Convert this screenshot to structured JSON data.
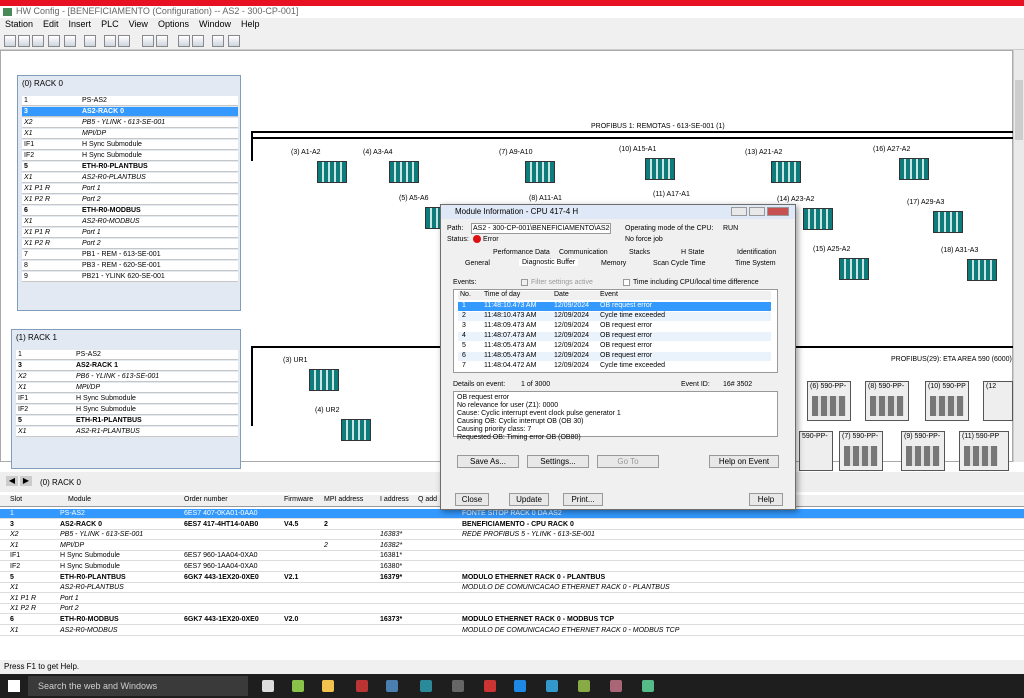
{
  "window": {
    "title": "HW Config - [BENEFICIAMENTO (Configuration) -- AS2 - 300-CP-001]"
  },
  "menu": [
    "Station",
    "Edit",
    "Insert",
    "PLC",
    "View",
    "Options",
    "Window",
    "Help"
  ],
  "racks": {
    "rack0": {
      "title": "(0) RACK 0",
      "rows": [
        {
          "slot": "1",
          "module": "PS-AS2",
          "style": ""
        },
        {
          "slot": "3",
          "module": "AS2-RACK 0",
          "style": "sel"
        },
        {
          "slot": "X2",
          "module": "PB5 - YLINK - 613-SE-001",
          "style": "it"
        },
        {
          "slot": "X1",
          "module": "MPI/DP",
          "style": "it"
        },
        {
          "slot": "IF1",
          "module": "H Sync Submodule",
          "style": ""
        },
        {
          "slot": "IF2",
          "module": "H Sync Submodule",
          "style": ""
        },
        {
          "slot": "5",
          "module": "ETH-R0-PLANTBUS",
          "style": "bold"
        },
        {
          "slot": "X1",
          "module": "AS2-R0-PLANTBUS",
          "style": "it"
        },
        {
          "slot": "X1 P1 R",
          "module": "Port 1",
          "style": "it"
        },
        {
          "slot": "X1 P2 R",
          "module": "Port 2",
          "style": "it"
        },
        {
          "slot": "6",
          "module": "ETH-R0-MODBUS",
          "style": "bold"
        },
        {
          "slot": "X1",
          "module": "AS2-R0-MODBUS",
          "style": "it"
        },
        {
          "slot": "X1 P1 R",
          "module": "Port 1",
          "style": "it"
        },
        {
          "slot": "X1 P2 R",
          "module": "Port 2",
          "style": "it"
        },
        {
          "slot": "7",
          "module": "PB1 - REM - 613-SE-001",
          "style": ""
        },
        {
          "slot": "8",
          "module": "PB3 - REM - 620-SE-001",
          "style": ""
        },
        {
          "slot": "9",
          "module": "PB21 - YLINK 620-SE-001",
          "style": ""
        }
      ]
    },
    "rack1": {
      "title": "(1) RACK 1",
      "rows": [
        {
          "slot": "1",
          "module": "PS-AS2",
          "style": ""
        },
        {
          "slot": "3",
          "module": "AS2-RACK 1",
          "style": "bold"
        },
        {
          "slot": "X2",
          "module": "PB6 - YLINK - 613-SE-001",
          "style": "it"
        },
        {
          "slot": "X1",
          "module": "MPI/DP",
          "style": "it"
        },
        {
          "slot": "IF1",
          "module": "H Sync Submodule",
          "style": ""
        },
        {
          "slot": "IF2",
          "module": "H Sync Submodule",
          "style": ""
        },
        {
          "slot": "5",
          "module": "ETH-R1-PLANTBUS",
          "style": "bold"
        },
        {
          "slot": "X1",
          "module": "AS2-R1-PLANTBUS",
          "style": "it"
        }
      ]
    }
  },
  "network": {
    "profibus1": "PROFIBUS 1: REMOTAS - 613-SE-001 (1)",
    "profibus29": "PROFIBUS(29): ETA AREA 590 (6000)",
    "slaves": [
      "(3) A1-A2",
      "(4) A3-A4",
      "(7) A9-A10",
      "(10) A15-A1",
      "(13) A21-A2",
      "(16) A27-A2",
      "(5) A5-A6",
      "(8) A11-A1",
      "(11) A17-A1",
      "(14) A23-A2",
      "(17) A29-A3",
      "(15) A25-A2",
      "(18) A31-A3",
      "(3) UR1",
      "(4) UR2"
    ],
    "pp_top": [
      "(6) 590-PP-",
      "(8) 590-PP-",
      "(10) 590-PP",
      "(12"
    ],
    "pp_bot": [
      "590-PP-",
      "(7) 590-PP-",
      "(9) 590-PP-",
      "(11) 590-PP"
    ]
  },
  "lower": {
    "rack_label": "(0)   RACK 0",
    "columns": [
      "Slot",
      "Module",
      "Order number",
      "Firmware",
      "MPI address",
      "I address",
      "Q add"
    ],
    "rows": [
      {
        "slot": "1",
        "module": "PS-AS2",
        "order": "6ES7 407-0KA01-0AA0",
        "fw": "",
        "mpi": "",
        "iaddr": "",
        "comment": "FONTE SITOP RACK 0 DA AS2",
        "style": "sel"
      },
      {
        "slot": "3",
        "module": "AS2-RACK 0",
        "order": "6ES7 417-4HT14-0AB0",
        "fw": "V4.5",
        "mpi": "2",
        "iaddr": "",
        "comment": "BENEFICIAMENTO - CPU RACK 0",
        "style": "bold"
      },
      {
        "slot": "X2",
        "module": "PB5 - YLINK - 613-SE-001",
        "order": "",
        "fw": "",
        "mpi": "",
        "iaddr": "16383*",
        "comment": "REDE PROFIBUS 5 - YLINK - 613-SE-001",
        "style": "it"
      },
      {
        "slot": "X1",
        "module": "MPI/DP",
        "order": "",
        "fw": "",
        "mpi": "2",
        "iaddr": "16382*",
        "comment": "",
        "style": "it"
      },
      {
        "slot": "IF1",
        "module": "H Sync Submodule",
        "order": "6ES7 960-1AA04-0XA0",
        "fw": "",
        "mpi": "",
        "iaddr": "16381*",
        "comment": "",
        "style": ""
      },
      {
        "slot": "IF2",
        "module": "H Sync Submodule",
        "order": "6ES7 960-1AA04-0XA0",
        "fw": "",
        "mpi": "",
        "iaddr": "16380*",
        "comment": "",
        "style": ""
      },
      {
        "slot": "5",
        "module": "ETH-R0-PLANTBUS",
        "order": "6GK7 443-1EX20-0XE0",
        "fw": "V2.1",
        "mpi": "",
        "iaddr": "16379*",
        "comment": "MODULO ETHERNET RACK 0 - PLANTBUS",
        "style": "bold"
      },
      {
        "slot": "X1",
        "module": "AS2-R0-PLANTBUS",
        "order": "",
        "fw": "",
        "mpi": "",
        "iaddr": "",
        "comment": "MODULO DE COMUNICACAO ETHERNET RACK 0 - PLANTBUS",
        "style": "it"
      },
      {
        "slot": "X1 P1 R",
        "module": "Port 1",
        "order": "",
        "fw": "",
        "mpi": "",
        "iaddr": "",
        "comment": "",
        "style": "it"
      },
      {
        "slot": "X1 P2 R",
        "module": "Port 2",
        "order": "",
        "fw": "",
        "mpi": "",
        "iaddr": "",
        "comment": "",
        "style": "it"
      },
      {
        "slot": "6",
        "module": "ETH-R0-MODBUS",
        "order": "6GK7 443-1EX20-0XE0",
        "fw": "V2.0",
        "mpi": "",
        "iaddr": "16373*",
        "comment": "MODULO ETHERNET RACK 0 - MODBUS TCP",
        "style": "bold"
      },
      {
        "slot": "X1",
        "module": "AS2-R0-MODBUS",
        "order": "",
        "fw": "",
        "mpi": "",
        "iaddr": "",
        "comment": "MODULO DE COMUNICACAO ETHERNET RACK 0 - MODBUS TCP",
        "style": "it"
      }
    ]
  },
  "status": "Press F1 to get Help.",
  "taskbar": {
    "search": "Search the web and Windows"
  },
  "dialog": {
    "title": "Module Information - CPU 417-4 H",
    "path_label": "Path:",
    "path": "AS2 - 300-CP-001\\BENEFICIAMENTO\\AS2-",
    "status_label": "Status:",
    "status": "Error",
    "op_mode_label": "Operating mode of the CPU:",
    "op_mode": "RUN",
    "force": "No force job",
    "tabs_row1": [
      "Performance Data",
      "Communication",
      "Stacks",
      "H State",
      "Identification"
    ],
    "tabs_row2": [
      "General",
      "Diagnostic Buffer",
      "Memory",
      "Scan Cycle Time",
      "Time System"
    ],
    "events_label": "Events:",
    "filter_label": "Filter settings active",
    "time_local_label": "Time including CPU/local time difference",
    "event_cols": [
      "No.",
      "Time of day",
      "Date",
      "Event"
    ],
    "events": [
      {
        "no": "1",
        "time": "11:48:10.473 AM",
        "date": "12/09/2024",
        "event": "OB request error"
      },
      {
        "no": "2",
        "time": "11:48:10.473 AM",
        "date": "12/09/2024",
        "event": "Cycle time exceeded"
      },
      {
        "no": "3",
        "time": "11:48:09.473 AM",
        "date": "12/09/2024",
        "event": "OB request error"
      },
      {
        "no": "4",
        "time": "11:48:07.473 AM",
        "date": "12/09/2024",
        "event": "OB request error"
      },
      {
        "no": "5",
        "time": "11:48:05.473 AM",
        "date": "12/09/2024",
        "event": "OB request error"
      },
      {
        "no": "6",
        "time": "11:48:05.473 AM",
        "date": "12/09/2024",
        "event": "OB request error"
      },
      {
        "no": "7",
        "time": "11:48:04.472 AM",
        "date": "12/09/2024",
        "event": "Cycle time exceeded"
      }
    ],
    "details_label": "Details on event:",
    "details_count": "1  of 3000",
    "event_id_label": "Event ID:",
    "event_id": "16# 3502",
    "details": [
      "OB request error",
      "No relevance for user (Z1): 0000",
      "Cause: Cyclic interrupt event clock pulse generator 1",
      "Causing OB: Cyclic interrupt OB (OB  30)",
      "Causing priority class:  7",
      "Requested OB: Timing error OB (OB80)"
    ],
    "buttons": {
      "save_as": "Save As...",
      "settings": "Settings...",
      "goto": "Go To",
      "help_event": "Help on Event",
      "close": "Close",
      "update": "Update",
      "print": "Print...",
      "help": "Help"
    }
  }
}
